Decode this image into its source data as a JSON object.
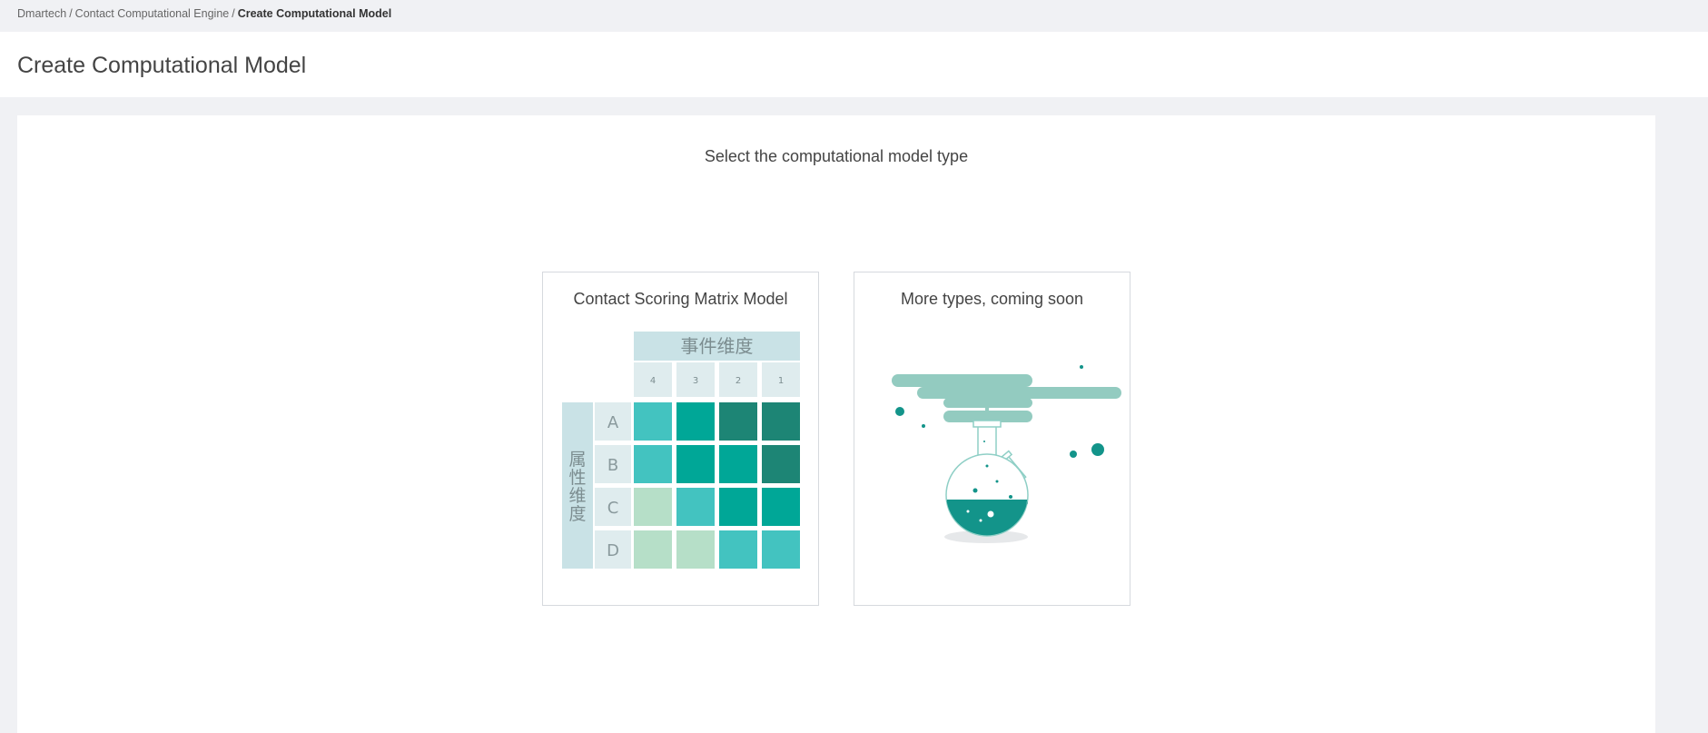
{
  "breadcrumb": {
    "items": [
      "Dmartech",
      "Contact Computational Engine"
    ],
    "current": "Create Computational Model",
    "separator": "/"
  },
  "page": {
    "title": "Create Computational Model",
    "subtitle": "Select the computational model type"
  },
  "cards": [
    {
      "title": "Contact Scoring Matrix Model",
      "illustration": "scoring-matrix",
      "matrix": {
        "column_header": "事件维度",
        "columns": [
          "4",
          "3",
          "2",
          "1"
        ],
        "row_header": "属性维度",
        "rows": [
          "A",
          "B",
          "C",
          "D"
        ],
        "cell_levels": [
          [
            2,
            3,
            4,
            4
          ],
          [
            2,
            3,
            3,
            4
          ],
          [
            1,
            2,
            3,
            3
          ],
          [
            1,
            1,
            2,
            2
          ]
        ]
      }
    },
    {
      "title": "More types, coming soon",
      "illustration": "flask-icon"
    }
  ],
  "colors": {
    "level1": "#b6dfc8",
    "level2": "#43c3c0",
    "level3": "#00a797",
    "level4": "#1d8575",
    "header_bg": "#c9e2e6",
    "subheader_bg": "#dfecee",
    "flask_green": "#13948a",
    "cloud": "#93cbc0"
  }
}
